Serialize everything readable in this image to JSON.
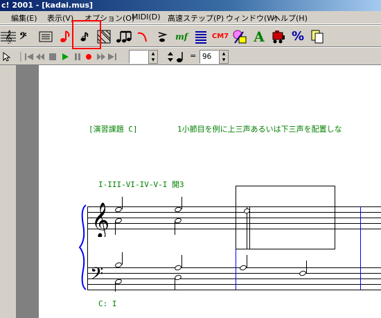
{
  "window": {
    "title": "c! 2001 - [kadai.mus]"
  },
  "menu": [
    {
      "label": "編集(E)"
    },
    {
      "label": "表示(V)"
    },
    {
      "label": "オプション(O)"
    },
    {
      "label": "MIDI(D)"
    },
    {
      "label": "高速ステップ(P)"
    },
    {
      "label": "ウィンドウ(W)"
    },
    {
      "label": "ヘルプ(H)"
    }
  ],
  "toolbar": {
    "chord_label": "CM7",
    "dynamic_label": "mf",
    "text_tool_label": "A",
    "percent_label": "%"
  },
  "transport": {
    "measure_value": "",
    "tempo_value": "96",
    "equals_label": "="
  },
  "score": {
    "exercise_heading": "[演習課題 C]",
    "instruction": "1小節目を例に上三声あるいは下三声を配置しな",
    "progression": "I-III-VI-IV-V-I  開3",
    "key_label": "C:  I"
  },
  "colors": {
    "annotation_green": "#008000",
    "barline_blue": "#0000ff",
    "highlight_red": "#ff0000"
  }
}
